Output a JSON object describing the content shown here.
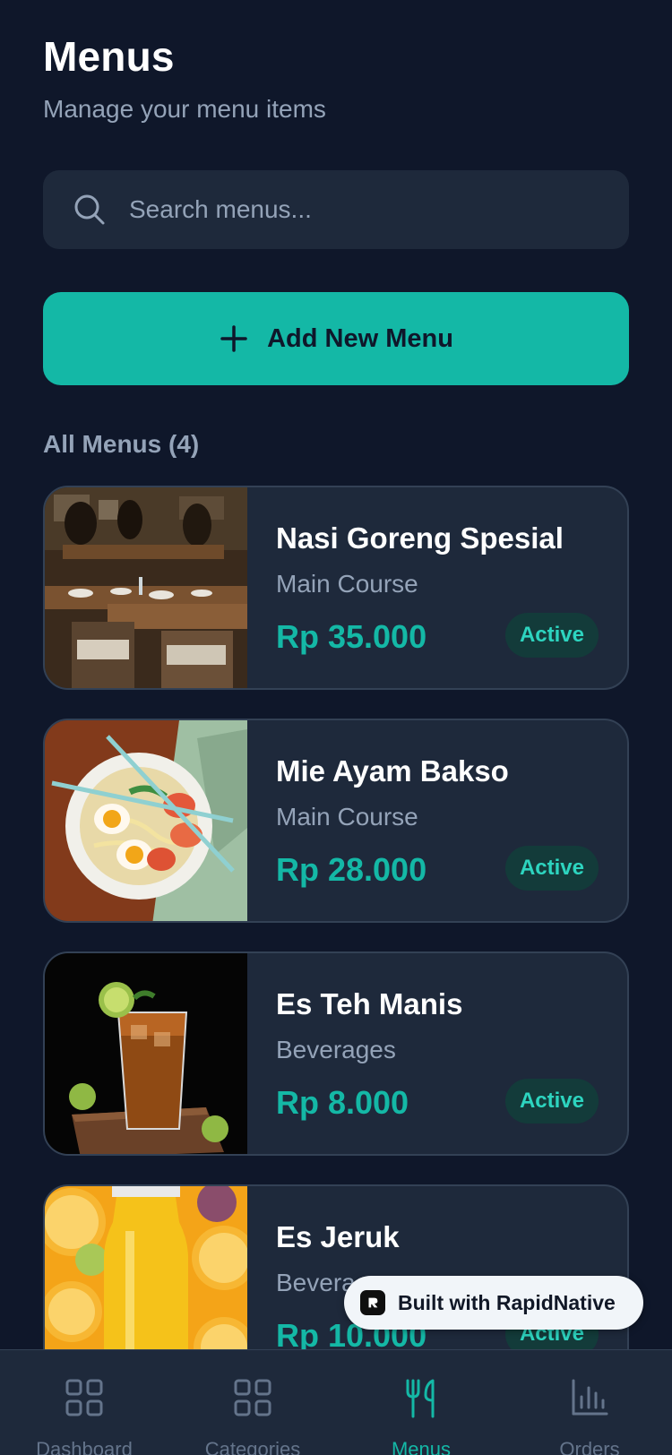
{
  "header": {
    "title": "Menus",
    "subtitle": "Manage your menu items"
  },
  "search": {
    "placeholder": "Search menus...",
    "icon": "search-icon"
  },
  "add_button": {
    "label": "Add New Menu",
    "icon": "plus-icon"
  },
  "section": {
    "title": "All Menus (4)"
  },
  "menus": [
    {
      "name": "Nasi Goreng Spesial",
      "category": "Main Course",
      "price": "Rp 35.000",
      "status": "Active",
      "image": "restaurant-interior"
    },
    {
      "name": "Mie Ayam Bakso",
      "category": "Main Course",
      "price": "Rp 28.000",
      "status": "Active",
      "image": "noodle-bowl"
    },
    {
      "name": "Es Teh Manis",
      "category": "Beverages",
      "price": "Rp 8.000",
      "status": "Active",
      "image": "iced-tea-glass"
    },
    {
      "name": "Es Jeruk",
      "category": "Beverages",
      "price": "Rp 10.000",
      "status": "Active",
      "image": "orange-juice-bottle"
    }
  ],
  "watermark": {
    "label": "Built with RapidNative"
  },
  "nav": {
    "items": [
      {
        "label": "Dashboard",
        "icon": "grid-icon",
        "active": false
      },
      {
        "label": "Categories",
        "icon": "grid-icon",
        "active": false
      },
      {
        "label": "Menus",
        "icon": "utensils-icon",
        "active": true
      },
      {
        "label": "Orders",
        "icon": "bar-chart-icon",
        "active": false
      }
    ]
  },
  "colors": {
    "background": "#0f172a",
    "surface": "#1e293b",
    "accent": "#14b8a6",
    "muted": "#94a3b8"
  }
}
